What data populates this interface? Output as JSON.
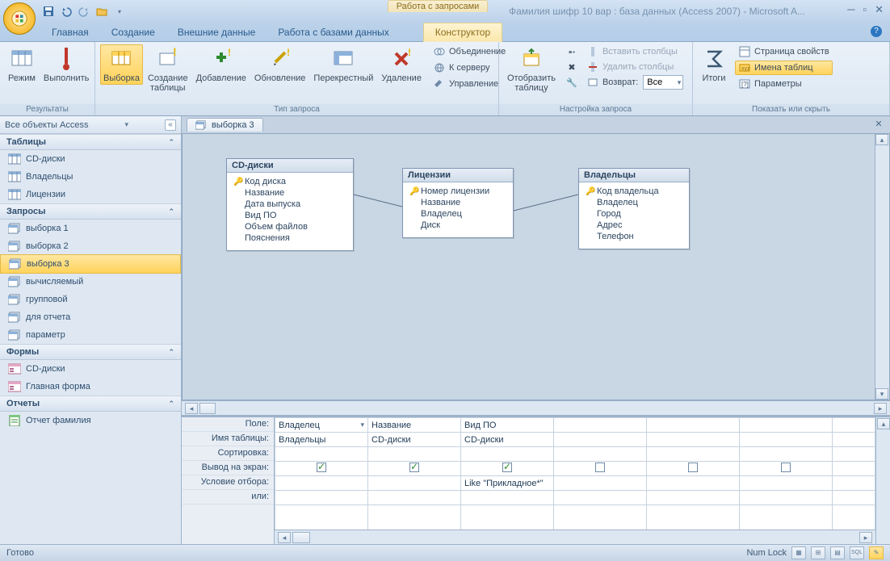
{
  "titlebar": {
    "contextual": "Работа с запросами",
    "document": "Фамилия шифр 10 вар : база данных (Access 2007) - Microsoft A..."
  },
  "tabs": {
    "home": "Главная",
    "create": "Создание",
    "external": "Внешние данные",
    "dbtools": "Работа с базами данных",
    "design": "Конструктор"
  },
  "ribbon": {
    "results": {
      "label": "Результаты",
      "view": "Режим",
      "run": "Выполнить"
    },
    "qtype": {
      "label": "Тип запроса",
      "select": "Выборка",
      "maketable": "Создание\nтаблицы",
      "append": "Добавление",
      "update": "Обновление",
      "crosstab": "Перекрестный",
      "delete": "Удаление",
      "union": "Объединение",
      "passthrough": "К серверу",
      "ddl": "Управление"
    },
    "qsetup": {
      "label": "Настройка запроса",
      "showtable": "Отобразить\nтаблицу",
      "insertrows": "",
      "deleterows": "",
      "builder": "",
      "insertcols": "Вставить столбцы",
      "deletecols": "Удалить столбцы",
      "return": "Возврат:",
      "return_val": "Все"
    },
    "showhide": {
      "label": "Показать или скрыть",
      "totals": "Итоги",
      "sheet": "Страница свойств",
      "tnames": "Имена таблиц",
      "params": "Параметры"
    }
  },
  "nav": {
    "header": "Все объекты Access",
    "tables": {
      "label": "Таблицы",
      "items": [
        "CD-диски",
        "Владельцы",
        "Лицензии"
      ]
    },
    "queries": {
      "label": "Запросы",
      "items": [
        "выборка 1",
        "выборка 2",
        "выборка 3",
        "вычисляемый",
        "групповой",
        "для отчета",
        "параметр"
      ],
      "selected": "выборка 3"
    },
    "forms": {
      "label": "Формы",
      "items": [
        "CD-диски",
        "Главная форма"
      ]
    },
    "reports": {
      "label": "Отчеты",
      "items": [
        "Отчет фамилия"
      ]
    }
  },
  "doc": {
    "tab": "выборка 3"
  },
  "tboxes": {
    "cd": {
      "title": "CD-диски",
      "key": "Код диска",
      "fields": [
        "Название",
        "Дата выпуска",
        "Вид ПО",
        "Объем файлов",
        "Пояснения"
      ]
    },
    "lic": {
      "title": "Лицензии",
      "key": "Номер лицензии",
      "fields": [
        "Название",
        "Владелец",
        "Диск"
      ]
    },
    "own": {
      "title": "Владельцы",
      "key": "Код владельца",
      "fields": [
        "Владелец",
        "Город",
        "Адрес",
        "Телефон"
      ]
    }
  },
  "grid": {
    "rows": [
      "Поле:",
      "Имя таблицы:",
      "Сортировка:",
      "Вывод на экран:",
      "Условие отбора:",
      "или:"
    ],
    "cols": [
      {
        "field": "Владелец",
        "table": "Владельцы",
        "show": true,
        "criteria": ""
      },
      {
        "field": "Название",
        "table": "CD-диски",
        "show": true,
        "criteria": ""
      },
      {
        "field": "Вид ПО",
        "table": "CD-диски",
        "show": true,
        "criteria": "Like \"Прикладное*\""
      },
      {
        "field": "",
        "table": "",
        "show": false,
        "criteria": ""
      },
      {
        "field": "",
        "table": "",
        "show": false,
        "criteria": ""
      },
      {
        "field": "",
        "table": "",
        "show": false,
        "criteria": ""
      }
    ]
  },
  "status": {
    "ready": "Готово",
    "numlock": "Num Lock"
  }
}
